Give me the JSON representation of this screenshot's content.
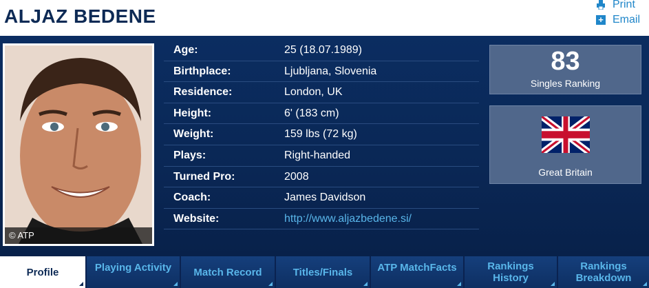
{
  "player": {
    "name": "ALJAZ BEDENE",
    "photo_credit": "© ATP"
  },
  "utility": {
    "print_label": "Print",
    "email_label": "Email",
    "email_icon_glyph": "+"
  },
  "info": [
    {
      "label": "Age:",
      "value": "25 (18.07.1989)"
    },
    {
      "label": "Birthplace:",
      "value": "Ljubljana, Slovenia"
    },
    {
      "label": "Residence:",
      "value": "London, UK"
    },
    {
      "label": "Height:",
      "value": "6' (183 cm)"
    },
    {
      "label": "Weight:",
      "value": "159 lbs (72 kg)"
    },
    {
      "label": "Plays:",
      "value": "Right-handed"
    },
    {
      "label": "Turned Pro:",
      "value": "2008"
    },
    {
      "label": "Coach:",
      "value": "James Davidson"
    },
    {
      "label": "Website:",
      "value": "http://www.aljazbedene.si/"
    }
  ],
  "ranking": {
    "number": "83",
    "label": "Singles Ranking"
  },
  "country": {
    "name": "Great Britain",
    "flag_icon": "uk-flag-icon"
  },
  "tabs": [
    {
      "line1": "Profile",
      "line2": ""
    },
    {
      "line1": "Playing Activity",
      "line2": ""
    },
    {
      "line1": "Match Record",
      "line2": ""
    },
    {
      "line1": "Titles/Finals",
      "line2": ""
    },
    {
      "line1": "ATP MatchFacts",
      "line2": ""
    },
    {
      "line1": "Rankings",
      "line2": "History"
    },
    {
      "line1": "Rankings",
      "line2": "Breakdown"
    }
  ],
  "colors": {
    "name_text": "#0d2a55",
    "link": "#1f86c9",
    "panel_bg": "#0b2d61",
    "box_bg": "#50678b",
    "tab_text": "#59b6ea"
  }
}
